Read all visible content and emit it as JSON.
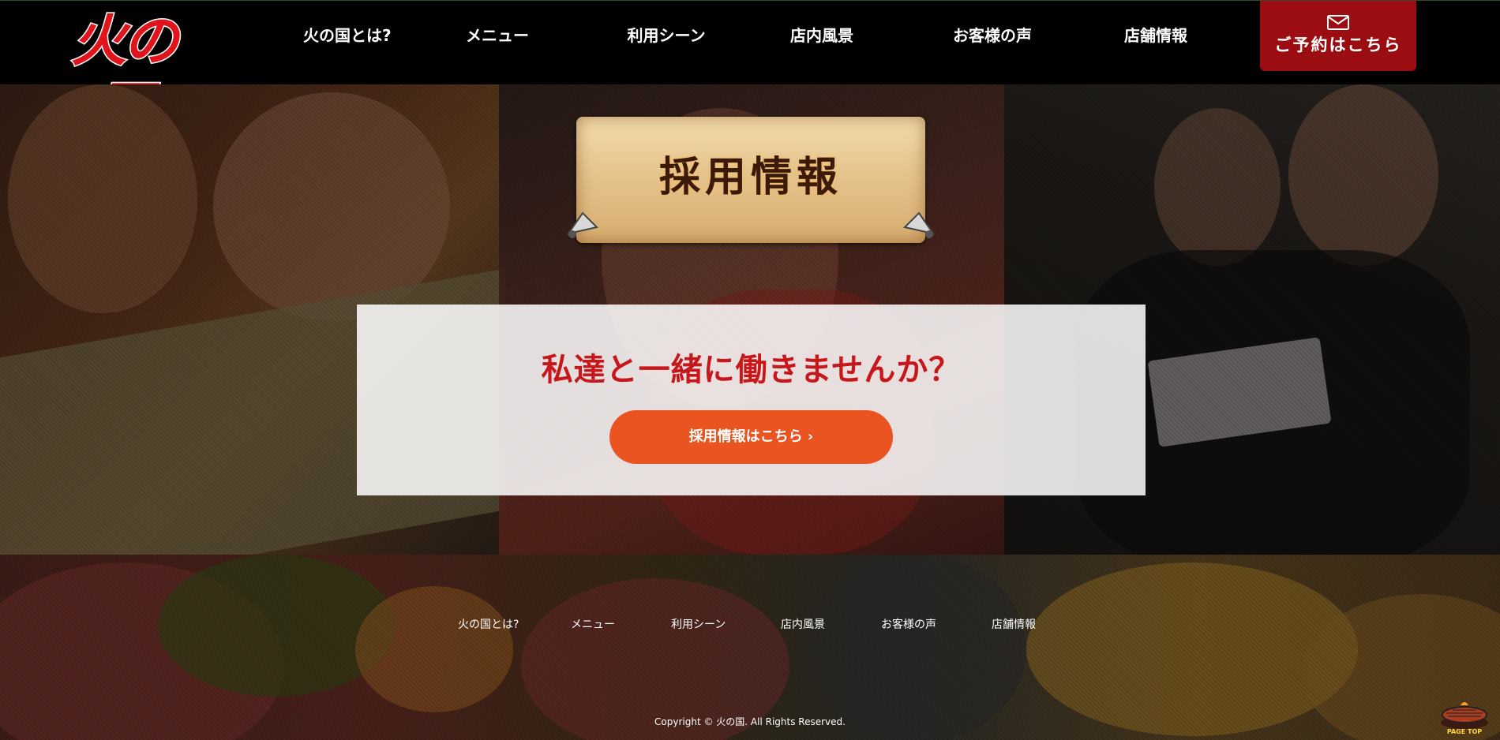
{
  "header": {
    "logo_text": "火の国",
    "nav": [
      {
        "label": "火の国とは?"
      },
      {
        "label": "メニュー"
      },
      {
        "label": "利用シーン"
      },
      {
        "label": "店内風景"
      },
      {
        "label": "お客様の声"
      },
      {
        "label": "店舗情報"
      }
    ],
    "reserve_label": "ご予約はこちら",
    "reserve_icon": "mail-icon"
  },
  "hero": {
    "sign_text": "採用情報",
    "recruit_title": "私達と一緒に働きませんか？",
    "recruit_button": "採用情報はこちら ›"
  },
  "footer": {
    "nav": [
      {
        "label": "火の国とは?"
      },
      {
        "label": "メニュー"
      },
      {
        "label": "利用シーン"
      },
      {
        "label": "店内風景"
      },
      {
        "label": "お客様の声"
      },
      {
        "label": "店舗情報"
      }
    ],
    "copyright": "Copyright ©   火の国.   All Rights Reserved.",
    "pagetop_label": "PAGE TOP"
  },
  "colors": {
    "brand_red": "#e1141b",
    "reserve_bg": "#9b0d10",
    "recruit_title": "#c8171b",
    "recruit_button": "#e95420"
  }
}
